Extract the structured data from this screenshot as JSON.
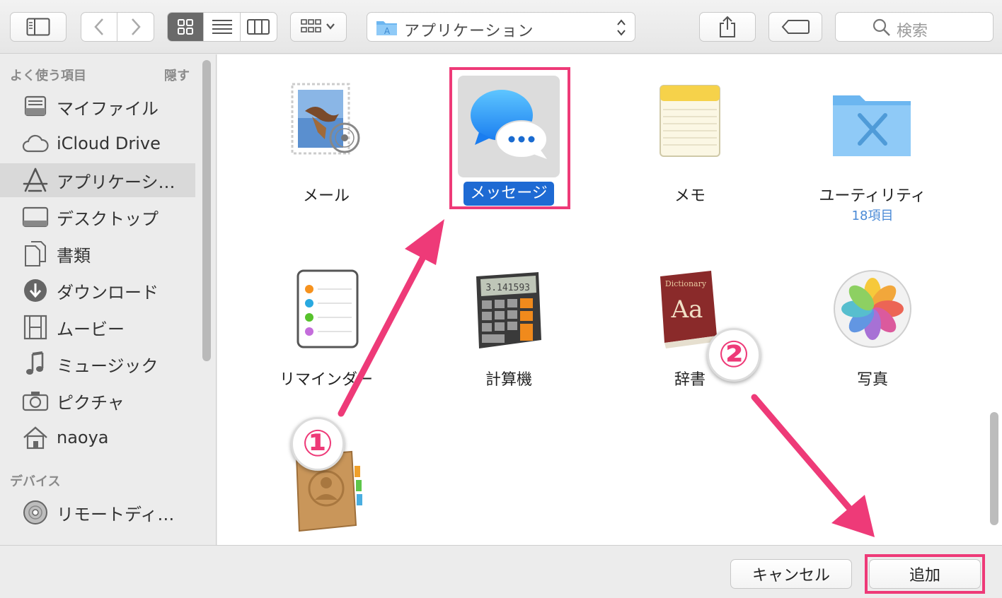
{
  "toolbar": {
    "path_label": "アプリケーション",
    "search_placeholder": "検索"
  },
  "sidebar": {
    "favorites_header": "よく使う項目",
    "hide_label": "隠す",
    "favorites": [
      {
        "label": "マイファイル",
        "icon": "all-my-files-icon"
      },
      {
        "label": "iCloud Drive",
        "icon": "cloud-icon"
      },
      {
        "label": "アプリケーシ…",
        "icon": "applications-icon",
        "selected": true
      },
      {
        "label": "デスクトップ",
        "icon": "desktop-icon"
      },
      {
        "label": "書類",
        "icon": "documents-icon"
      },
      {
        "label": "ダウンロード",
        "icon": "download-icon"
      },
      {
        "label": "ムービー",
        "icon": "film-icon"
      },
      {
        "label": "ミュージック",
        "icon": "music-note-icon"
      },
      {
        "label": "ピクチャ",
        "icon": "camera-icon"
      },
      {
        "label": "naoya",
        "icon": "home-icon"
      }
    ],
    "devices_header": "デバイス",
    "devices": [
      {
        "label": "リモートディ…",
        "icon": "disc-icon"
      }
    ]
  },
  "apps": [
    {
      "label": "メール",
      "icon": "mail-stamp-icon"
    },
    {
      "label": "メッセージ",
      "icon": "messages-icon",
      "selected": true
    },
    {
      "label": "メモ",
      "icon": "notes-icon"
    },
    {
      "label": "ユーティリティ",
      "sublabel": "18項目",
      "icon": "utilities-folder-icon"
    },
    {
      "label": "リマインダー",
      "icon": "reminders-icon"
    },
    {
      "label": "計算機",
      "icon": "calculator-icon"
    },
    {
      "label": "辞書",
      "icon": "dictionary-icon"
    },
    {
      "label": "写真",
      "icon": "photos-icon"
    },
    {
      "label": "",
      "icon": "contacts-icon"
    }
  ],
  "calculator_display": "3.141593",
  "dictionary_title": "Dictionary",
  "dictionary_glyph": "Aa",
  "footer": {
    "cancel_label": "キャンセル",
    "add_label": "追加"
  },
  "annotations": {
    "step1": "①",
    "step2": "②",
    "color": "#ee3a78"
  }
}
